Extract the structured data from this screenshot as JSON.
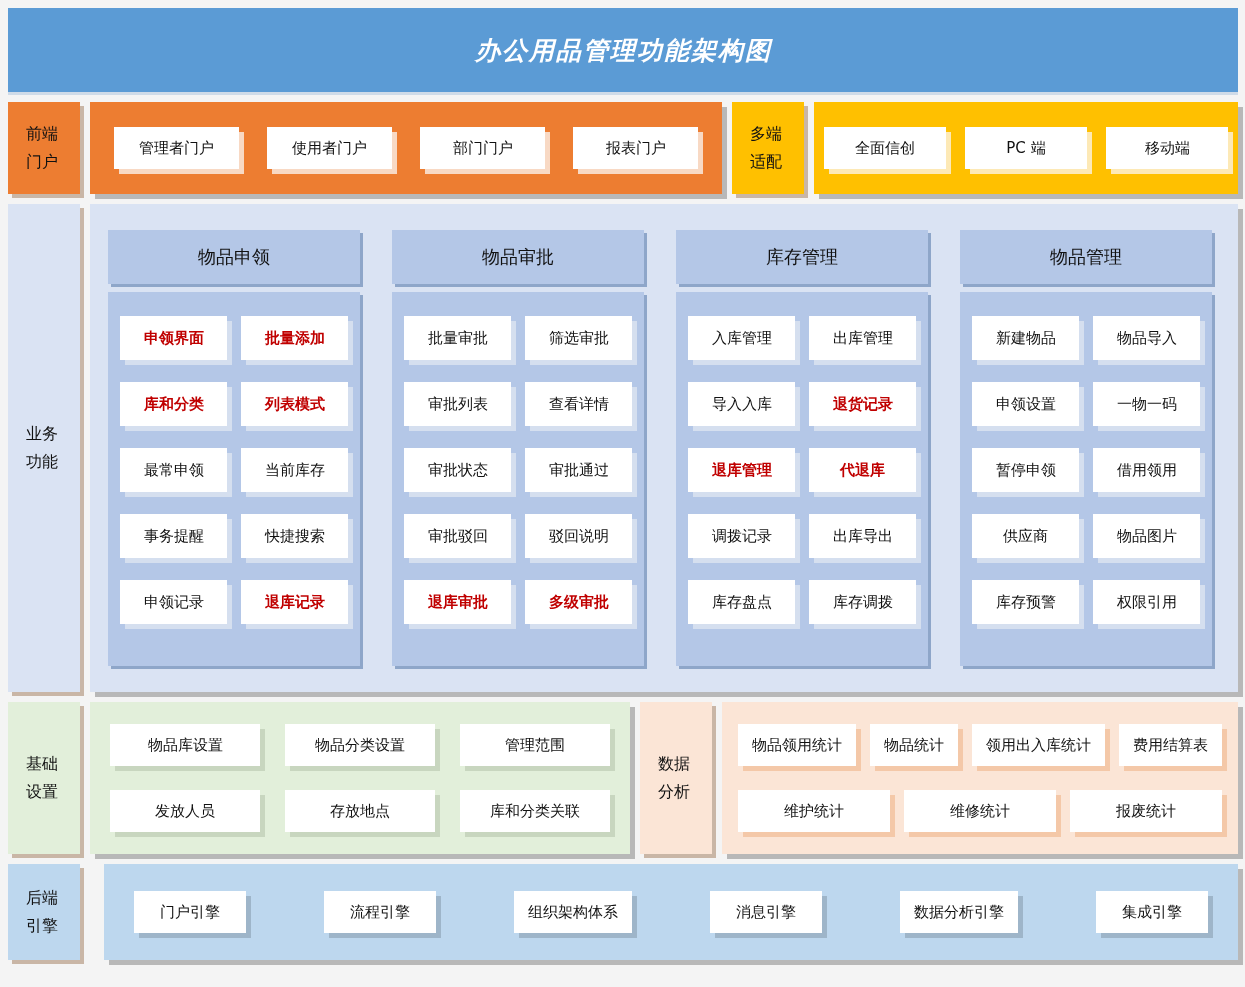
{
  "title": "办公用品管理功能架构图",
  "frontend": {
    "label": "前端门户",
    "items": [
      "管理者门户",
      "使用者门户",
      "部门门户",
      "报表门户"
    ]
  },
  "multi_terminal": {
    "label": "多端适配",
    "items": [
      "全面信创",
      "PC 端",
      "移动端"
    ]
  },
  "business": {
    "label": "业务功能",
    "modules": [
      {
        "title": "物品申领",
        "items": [
          {
            "text": "申领界面",
            "emphasis": true
          },
          {
            "text": "批量添加",
            "emphasis": true
          },
          {
            "text": "库和分类",
            "emphasis": true
          },
          {
            "text": "列表模式",
            "emphasis": true
          },
          {
            "text": "最常申领",
            "emphasis": false
          },
          {
            "text": "当前库存",
            "emphasis": false
          },
          {
            "text": "事务提醒",
            "emphasis": false
          },
          {
            "text": "快捷搜索",
            "emphasis": false
          },
          {
            "text": "申领记录",
            "emphasis": false
          },
          {
            "text": "退库记录",
            "emphasis": true
          }
        ]
      },
      {
        "title": "物品审批",
        "items": [
          {
            "text": "批量审批",
            "emphasis": false
          },
          {
            "text": "筛选审批",
            "emphasis": false
          },
          {
            "text": "审批列表",
            "emphasis": false
          },
          {
            "text": "查看详情",
            "emphasis": false
          },
          {
            "text": "审批状态",
            "emphasis": false
          },
          {
            "text": "审批通过",
            "emphasis": false
          },
          {
            "text": "审批驳回",
            "emphasis": false
          },
          {
            "text": "驳回说明",
            "emphasis": false
          },
          {
            "text": "退库审批",
            "emphasis": true
          },
          {
            "text": "多级审批",
            "emphasis": true
          }
        ]
      },
      {
        "title": "库存管理",
        "items": [
          {
            "text": "入库管理",
            "emphasis": false
          },
          {
            "text": "出库管理",
            "emphasis": false
          },
          {
            "text": "导入入库",
            "emphasis": false
          },
          {
            "text": "退货记录",
            "emphasis": true
          },
          {
            "text": "退库管理",
            "emphasis": true
          },
          {
            "text": "代退库",
            "emphasis": true
          },
          {
            "text": "调拨记录",
            "emphasis": false
          },
          {
            "text": "出库导出",
            "emphasis": false
          },
          {
            "text": "库存盘点",
            "emphasis": false
          },
          {
            "text": "库存调拨",
            "emphasis": false
          }
        ]
      },
      {
        "title": "物品管理",
        "items": [
          {
            "text": "新建物品",
            "emphasis": false
          },
          {
            "text": "物品导入",
            "emphasis": false
          },
          {
            "text": "申领设置",
            "emphasis": false
          },
          {
            "text": "一物一码",
            "emphasis": false
          },
          {
            "text": "暂停申领",
            "emphasis": false
          },
          {
            "text": "借用领用",
            "emphasis": false
          },
          {
            "text": "供应商",
            "emphasis": false
          },
          {
            "text": "物品图片",
            "emphasis": false
          },
          {
            "text": "库存预警",
            "emphasis": false
          },
          {
            "text": "权限引用",
            "emphasis": false
          }
        ]
      }
    ]
  },
  "base_settings": {
    "label": "基础设置",
    "items": [
      "物品库设置",
      "物品分类设置",
      "管理范围",
      "发放人员",
      "存放地点",
      "库和分类关联"
    ]
  },
  "data_analysis": {
    "label": "数据分析",
    "items": [
      "物品领用统计",
      "物品统计",
      "领用出入库统计",
      "费用结算表",
      "维护统计",
      "维修统计",
      "报废统计"
    ]
  },
  "backend": {
    "label": "后端引擎",
    "items": [
      "门户引擎",
      "流程引擎",
      "组织架构体系",
      "消息引擎",
      "数据分析引擎",
      "集成引擎"
    ]
  }
}
